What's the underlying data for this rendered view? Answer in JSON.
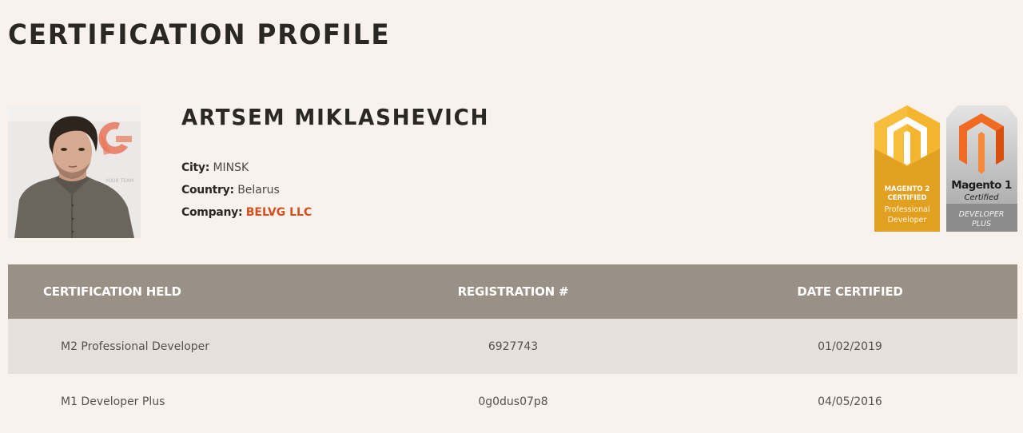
{
  "page": {
    "title": "CERTIFICATION PROFILE"
  },
  "profile": {
    "name": "ARTSEM MIKLASHEVICH",
    "photo_icon": "profile-photo",
    "city_label": "City:",
    "city": "MINSK",
    "country_label": "Country:",
    "country": "Belarus",
    "company_label": "Company:",
    "company": "BELVG LLC",
    "company_color": "#d4501e"
  },
  "badges": [
    {
      "name": "magento-2-certified-professional-developer-badge",
      "line1": "MAGENTO 2",
      "line2": "CERTIFIED",
      "line3": "Professional",
      "line4": "Developer",
      "color": "#f2ad2b"
    },
    {
      "name": "magento-1-certified-developer-plus-badge",
      "line1": "Magento 1",
      "line2": "Certified",
      "line3": "DEVELOPER",
      "line4": "PLUS",
      "color": "#f06a22"
    }
  ],
  "table": {
    "headers": [
      "CERTIFICATION HELD",
      "REGISTRATION #",
      "DATE CERTIFIED"
    ],
    "rows": [
      {
        "certification": "M2 Professional Developer",
        "registration": "6927743",
        "date": "01/02/2019"
      },
      {
        "certification": "M1 Developer Plus",
        "registration": "0g0dus07p8",
        "date": "04/05/2016"
      }
    ],
    "header_color": "#9a9186",
    "alt_row_color": "#e5e0da"
  }
}
